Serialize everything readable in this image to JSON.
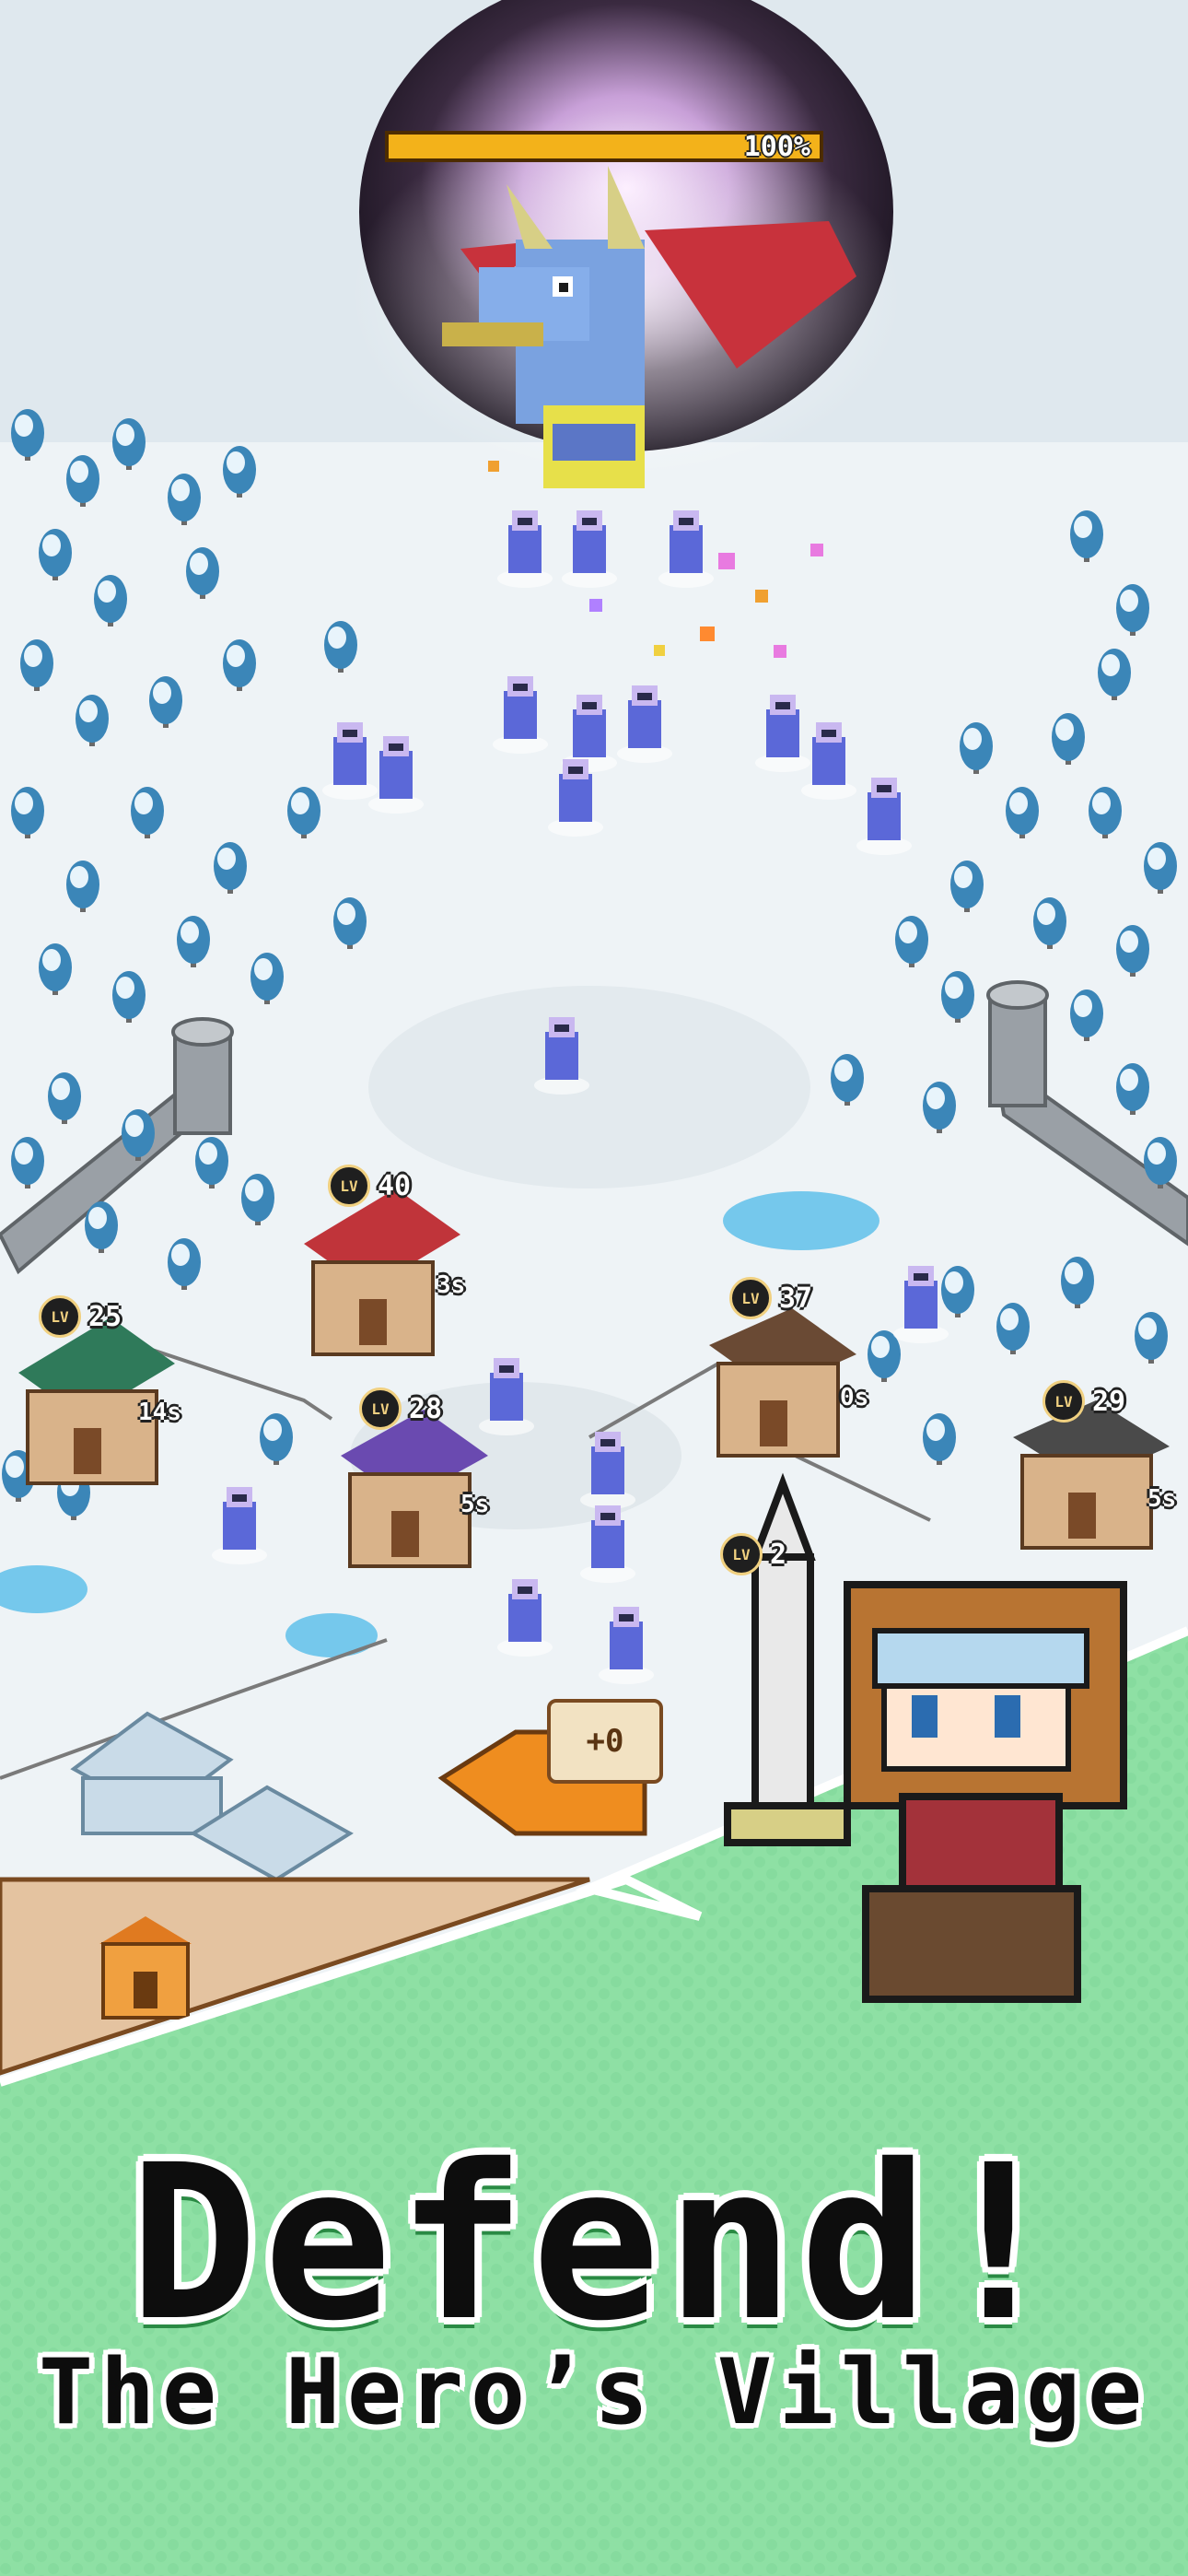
{
  "boss": {
    "hp_percent": "100%"
  },
  "buildings": [
    {
      "level": "40",
      "timer": "3s"
    },
    {
      "level": "25",
      "timer": "14s"
    },
    {
      "level": "28",
      "timer": "5s"
    },
    {
      "level": "37",
      "timer": "0s"
    },
    {
      "level": "29",
      "timer": "5s"
    },
    {
      "level": "2",
      "timer": ""
    }
  ],
  "lv_label": "LV",
  "sign_text": "+0",
  "banner": {
    "headline": "Defend!",
    "subhead": "The Hero’s Village"
  },
  "colors": {
    "snow": "#eef3f6",
    "tree": "#3b86b8",
    "banner_green": "#8ee0a4",
    "hp": "#f3b21a"
  }
}
